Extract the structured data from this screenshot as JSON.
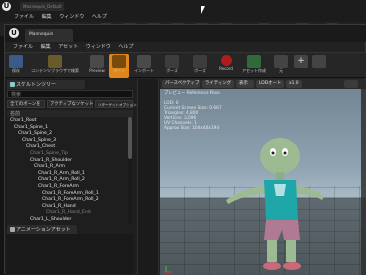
{
  "back_window": {
    "title": "Mannequin_Default",
    "menu": [
      "ファイル",
      "編集",
      "ウィンドウ",
      "ヘルプ"
    ]
  },
  "editor": {
    "tab_title": "Mannequin",
    "menu": [
      "ファイル",
      "編集",
      "アセット",
      "ウィンドウ",
      "ヘルプ"
    ],
    "toolbar": [
      {
        "label": "保存",
        "icon": "save-icon"
      },
      {
        "label": "コンテンツブラウザで検索",
        "icon": "browse-icon"
      },
      {
        "label": "Preview",
        "icon": "preview-icon"
      },
      {
        "label": "ボーン",
        "icon": "bone-icon",
        "active": true
      },
      {
        "label": "インポート",
        "icon": "import-icon"
      },
      {
        "label": "ポーズ",
        "icon": "pose-icon"
      },
      {
        "label": "ポーズ",
        "icon": "pose2-icon"
      },
      {
        "label": "Record",
        "icon": "record-icon"
      },
      {
        "label": "アセット作成",
        "icon": "create-asset-icon"
      },
      {
        "label": "元",
        "icon": "undo-icon"
      },
      {
        "label": "",
        "icon": "add-icon"
      },
      {
        "label": "",
        "icon": "remove-icon"
      }
    ],
    "accent": "#e0861a"
  },
  "skeleton_panel": {
    "tab": "スケルトンツリー",
    "search_placeholder": "検索",
    "filter_all": "全てのボーンを",
    "filter_active": "アクティブなソケット",
    "filter_retarget": "リターゲットオプションを表示",
    "header": "名前",
    "bones": [
      {
        "name": "Char1_Root",
        "level": 0
      },
      {
        "name": "Char1_Spine_1",
        "level": 1
      },
      {
        "name": "Char1_Spine_2",
        "level": 2
      },
      {
        "name": "Char1_Spine_3",
        "level": 3
      },
      {
        "name": "Char1_Chest",
        "level": 4
      },
      {
        "name": "Char1_Spine_Tip",
        "level": 5,
        "dim": true
      },
      {
        "name": "Char1_R_Shoulder",
        "level": 5
      },
      {
        "name": "Char1_R_Arm",
        "level": 6
      },
      {
        "name": "Char1_R_Arm_Roll_1",
        "level": 7
      },
      {
        "name": "Char1_R_Arm_Roll_2",
        "level": 7
      },
      {
        "name": "Char1_R_ForeArm",
        "level": 7
      },
      {
        "name": "Char1_R_ForeArm_Roll_1",
        "level": 8
      },
      {
        "name": "Char1_R_ForeArm_Roll_2",
        "level": 8
      },
      {
        "name": "Char1_R_Hand",
        "level": 8
      },
      {
        "name": "Char1_R_Hand_End",
        "level": 9,
        "dim": true
      },
      {
        "name": "Char1_L_Shoulder",
        "level": 5
      }
    ]
  },
  "asset_panel": {
    "tab": "アニメーションアセット"
  },
  "viewport": {
    "tabs": [
      "パースペクティブ",
      "ライティング",
      "表示",
      "LODオート",
      "x1.0"
    ],
    "info": [
      "プレビュー Reference Pose",
      "LOD: 0",
      "Current Screen Size: 0.667",
      "Triangles: 4,800",
      "Vertices: 3,096",
      "UV Channels: 1",
      "Approx Size: 104x40x194"
    ]
  }
}
